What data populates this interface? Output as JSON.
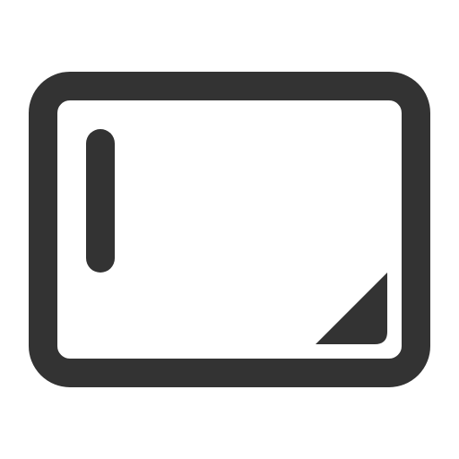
{
  "icon": {
    "name": "tablet-window-icon",
    "color": "#333333",
    "background": "#ffffff"
  }
}
